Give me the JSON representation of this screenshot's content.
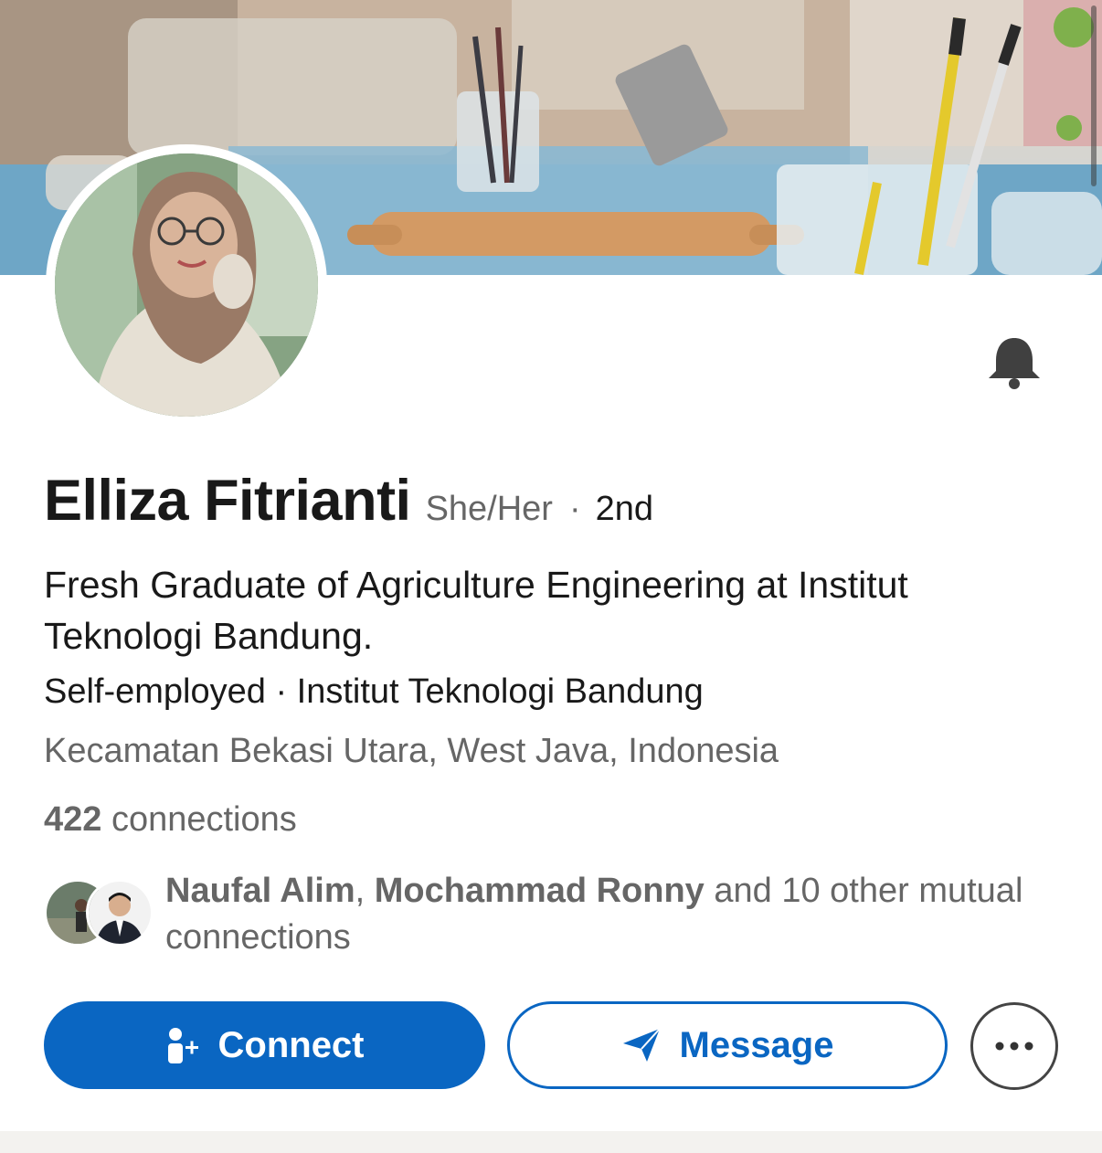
{
  "profile": {
    "name": "Elliza Fitrianti",
    "pronouns": "She/Her",
    "degree_separator": "·",
    "connection_degree": "2nd",
    "headline": "Fresh Graduate of Agriculture Engineering at Institut Teknologi Bandung.",
    "workplace": "Self-employed · Institut Teknologi Bandung",
    "location": "Kecamatan Bekasi Utara, West Java, Indonesia",
    "connections_count": "422",
    "connections_label": "connections"
  },
  "mutual": {
    "name_1": "Naufal Alim",
    "separator": ",",
    "name_2": "Mochammad Ronny",
    "suffix": "and 10 other mutual connections"
  },
  "actions": {
    "connect_label": "Connect",
    "message_label": "Message"
  },
  "icons": {
    "bell": "bell-icon",
    "connect": "add-person-icon",
    "message": "send-icon",
    "more": "ellipsis-icon"
  },
  "colors": {
    "primary": "#0a66c2",
    "text_primary": "#191919",
    "text_secondary": "#666666"
  }
}
